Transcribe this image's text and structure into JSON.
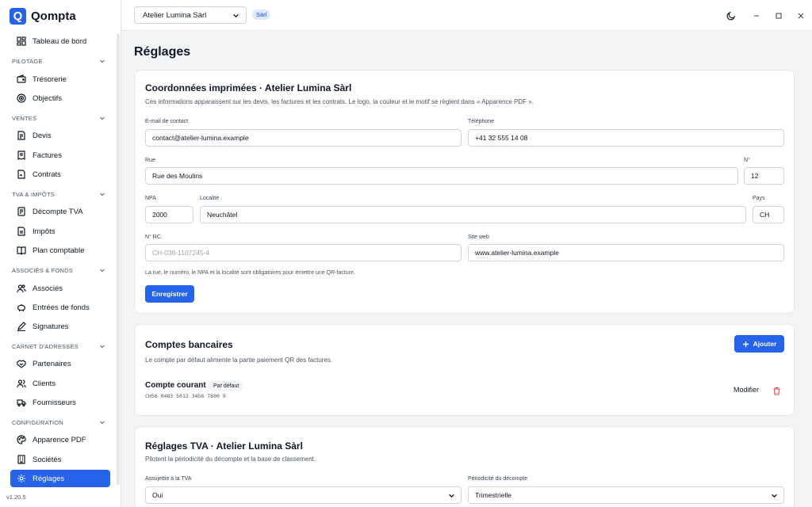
{
  "app": {
    "name": "Qompta",
    "logo_letter": "Q",
    "version": "v1.20.5"
  },
  "sidebar": {
    "dashboard": "Tableau de bord",
    "sections": [
      {
        "title": "PILOTAGE",
        "items": [
          "Trésorerie",
          "Objectifs"
        ]
      },
      {
        "title": "VENTES",
        "items": [
          "Devis",
          "Factures",
          "Contrats"
        ]
      },
      {
        "title": "TVA & IMPÔTS",
        "items": [
          "Décompte TVA",
          "Impôts",
          "Plan comptable"
        ]
      },
      {
        "title": "ASSOCIÉS & FONDS",
        "items": [
          "Associés",
          "Entrées de fonds",
          "Signatures"
        ]
      },
      {
        "title": "CARNET D'ADRESSES",
        "items": [
          "Partenaires",
          "Clients",
          "Fournisseurs"
        ]
      },
      {
        "title": "CONFIGURATION",
        "items": [
          "Apparence PDF",
          "Sociétés",
          "Réglages"
        ]
      }
    ],
    "active_item": "Réglages"
  },
  "topbar": {
    "company": "Atelier Lumina Sàrl",
    "company_badge": "Sàrl"
  },
  "page": {
    "title": "Réglages"
  },
  "contact_card": {
    "title": "Coordonnées imprimées · Atelier Lumina Sàrl",
    "subtitle": "Ces informations apparaissent sur les devis, les factures et les contrats. Le logo, la couleur et le motif se règlent dans « Apparence PDF ».",
    "email_label": "E-mail de contact",
    "email_value": "contact@atelier-lumina.example",
    "phone_label": "Téléphone",
    "phone_value": "+41 32 555 14 08",
    "street_label": "Rue",
    "street_value": "Rue des Moulins",
    "number_label": "N°",
    "number_value": "12",
    "npa_label": "NPA",
    "npa_value": "2000",
    "locality_label": "Localité",
    "locality_value": "Neuchâtel",
    "country_label": "Pays",
    "country_value": "CH",
    "rc_label": "N° RC",
    "rc_placeholder": "CH-036-1107245-4",
    "website_label": "Site web",
    "website_value": "www.atelier-lumina.example",
    "note": "La rue, le numéro, le NPA et la localité sont obligatoires pour émettre une QR-facture.",
    "save_label": "Enregistrer"
  },
  "bank_card": {
    "title": "Comptes bancaires",
    "subtitle": "Le compte par défaut alimente la partie paiement QR des factures.",
    "add_label": "Ajouter",
    "account_name": "Compte courant",
    "default_badge": "Par défaut",
    "iban": "CH56 0483 5012 3456 7800 9",
    "modify_label": "Modifier"
  },
  "vat_card": {
    "title": "Réglages TVA · Atelier Lumina Sàrl",
    "subtitle": "Pilotent la périodicité du décompte et la base de classement.",
    "subject_label": "Assujettie à la TVA",
    "subject_value": "Oui",
    "period_label": "Périodicité du décompte",
    "period_value": "Trimestrielle"
  },
  "colors": {
    "accent": "#2563eb",
    "badge_bg": "#dbeafe",
    "danger": "#ef4444"
  }
}
